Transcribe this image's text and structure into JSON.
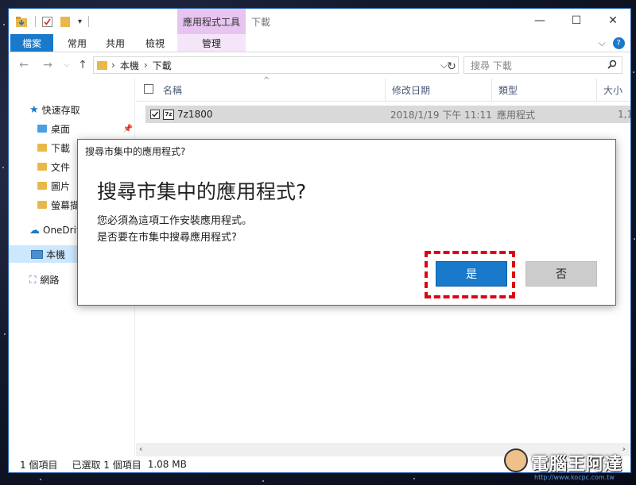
{
  "window": {
    "title": "下載",
    "contextual_tab_title": "應用程式工具",
    "minimize_symbol": "—",
    "maximize_symbol": "☐",
    "close_symbol": "✕"
  },
  "ribbon": {
    "tabs": [
      "檔案",
      "常用",
      "共用",
      "檢視"
    ],
    "manage_tab": "管理",
    "expand_symbol": "⌵",
    "help_symbol": "?"
  },
  "navbar": {
    "breadcrumb": [
      "本機",
      "下載"
    ],
    "search_placeholder": "搜尋 下載"
  },
  "navpane": {
    "quick_access": "快速存取",
    "items": [
      "桌面",
      "下載",
      "文件",
      "圖片",
      "螢幕擷"
    ],
    "onedrive": "OneDriv",
    "this_pc": "本機",
    "network": "網路"
  },
  "filelist": {
    "columns": [
      "名稱",
      "修改日期",
      "類型",
      "大小"
    ],
    "rows": [
      {
        "name": "7z1800",
        "date": "2018/1/19 下午 11:11",
        "type": "應用程式",
        "size": "1,1"
      }
    ]
  },
  "statusbar": {
    "count": "1 個項目",
    "selected": "已選取 1 個項目",
    "size": "1.08 MB"
  },
  "dialog": {
    "title": "搜尋市集中的應用程式?",
    "heading": "搜尋市集中的應用程式?",
    "line1": "您必須為這項工作安裝應用程式。",
    "line2": "是否要在市集中搜尋應用程式?",
    "yes": "是",
    "no": "否"
  },
  "watermark": {
    "text": "電腦王阿達",
    "url": "http://www.kocpc.com.tw"
  },
  "colors": {
    "accent": "#1979ca",
    "highlight": "#e00010",
    "contextual_tab": "#e7c5f0"
  }
}
